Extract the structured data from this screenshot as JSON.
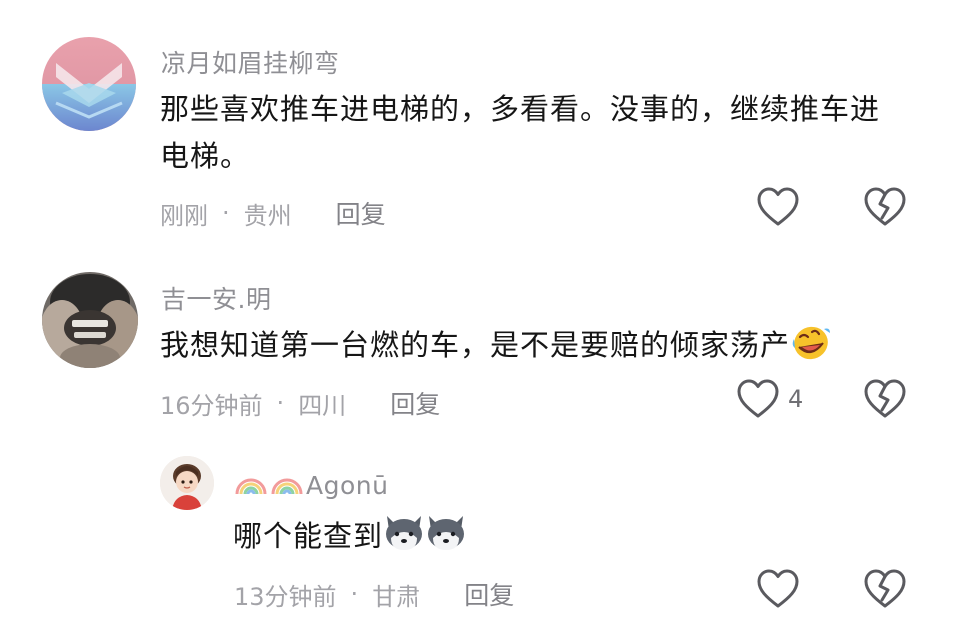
{
  "comments": [
    {
      "username": "凉月如眉挂柳弯",
      "content": "那些喜欢推车进电梯的，多看看。没事的，继续推车进电梯。",
      "time": "刚刚",
      "location": "贵州",
      "reply_label": "回复",
      "like_count": ""
    },
    {
      "username": "吉一安.明",
      "content": "我想知道第一台燃的车，是不是要赔的倾家荡产",
      "content_emoji": "rofl-emoji",
      "time": "16分钟前",
      "location": "四川",
      "reply_label": "回复",
      "like_count": "4"
    }
  ],
  "reply": {
    "username": "Agonū",
    "username_prefix_icons": [
      "rainbow-icon",
      "rainbow-icon"
    ],
    "content": "哪个能查到",
    "content_emojis": [
      "husky-emoji",
      "husky-emoji"
    ],
    "time": "13分钟前",
    "location": "甘肃",
    "reply_label": "回复",
    "like_count": ""
  },
  "colors": {
    "username": "#8f8f94",
    "content": "#161616",
    "meta": "#a3a3a8",
    "icon_stroke": "#5a5a5f"
  }
}
